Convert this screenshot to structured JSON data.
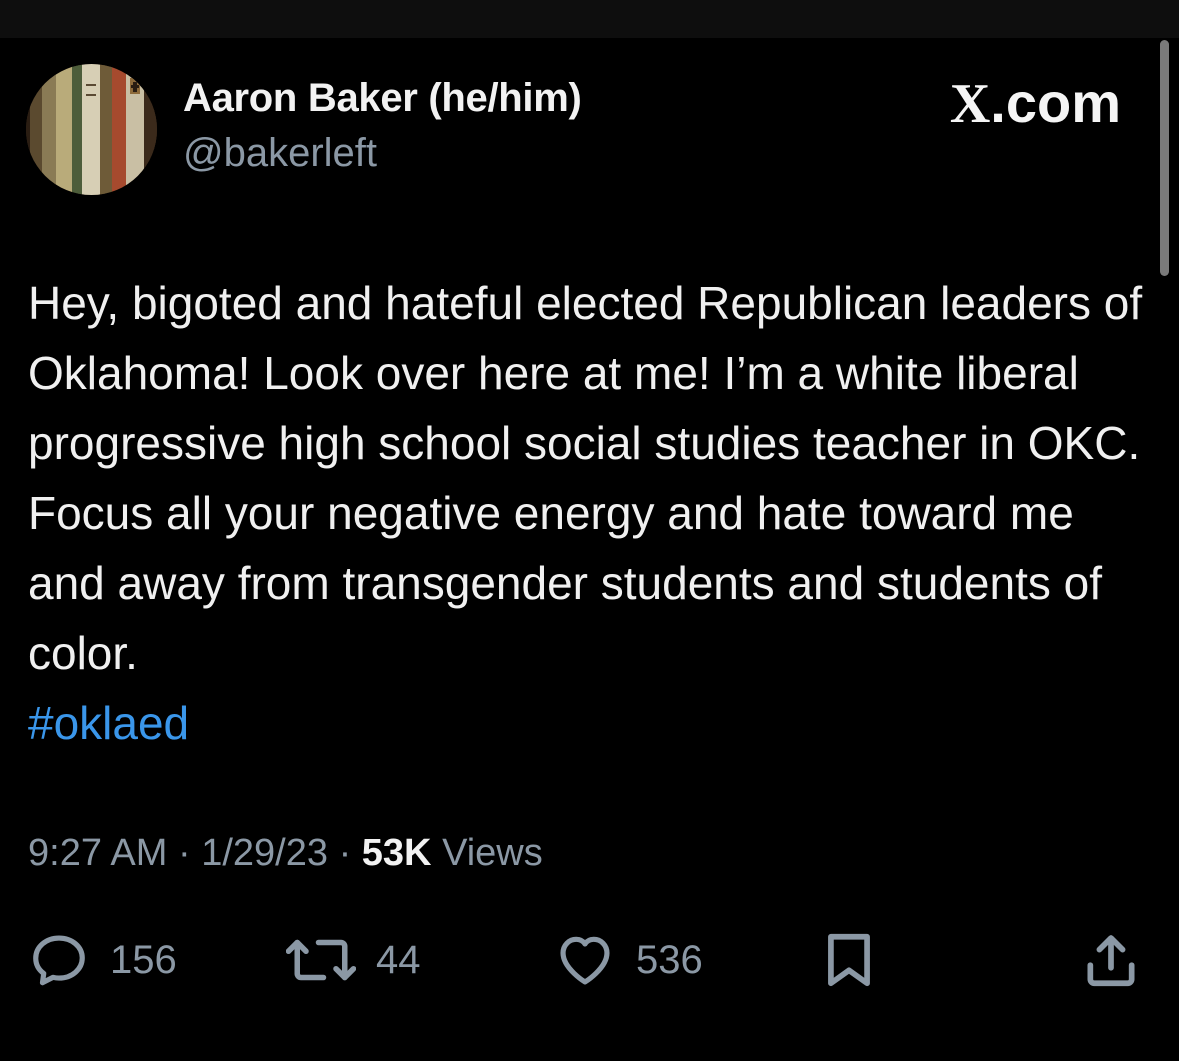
{
  "author": {
    "display_name": "Aaron Baker (he/him)",
    "handle": "@bakerleft",
    "avatar_icon": "avatar-bookshelf"
  },
  "brand": {
    "x_letter": "X",
    "suffix": ".com"
  },
  "tweet": {
    "text": "Hey, bigoted and hateful elected Republican leaders of Oklahoma! Look over here at me! I’m a white liberal progressive high school social studies teacher in OKC. Focus all your negative energy and hate toward me and away from transgender students and students of color.",
    "hashtag": "#oklaed"
  },
  "meta": {
    "time": "9:27 AM",
    "separator": "·",
    "date": "1/29/23",
    "views_count": "53K",
    "views_label": "Views"
  },
  "actions": {
    "reply": {
      "icon": "reply-icon",
      "count": "156"
    },
    "repost": {
      "icon": "repost-icon",
      "count": "44"
    },
    "like": {
      "icon": "heart-icon",
      "count": "536"
    },
    "bookmark": {
      "icon": "bookmark-icon"
    },
    "share": {
      "icon": "share-icon"
    }
  },
  "colors": {
    "background": "#000000",
    "text": "#e7e9ea",
    "secondary": "#8b98a5",
    "link": "#3a96ea"
  }
}
